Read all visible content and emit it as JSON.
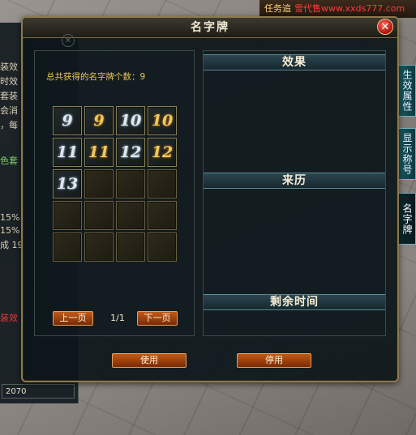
{
  "top_bar": {
    "task_label": "任务追",
    "watermark": "雪代售www.xxds777.com"
  },
  "background_left": {
    "lines": [
      "装效",
      "时效",
      "套装",
      "会消",
      "，每",
      "色套"
    ],
    "stats": [
      "15%",
      "15%",
      "成 19"
    ],
    "red_text": "装效",
    "footer_value": "2070"
  },
  "side_tabs": [
    {
      "label": "生效属性"
    },
    {
      "label": "显示称号"
    },
    {
      "label": "名字牌"
    }
  ],
  "window": {
    "title": "名字牌",
    "close_symbol": "✕",
    "count_label": "总共获得的名字牌个数：9",
    "slots": [
      {
        "text": "9",
        "tone": "silver"
      },
      {
        "text": "9",
        "tone": "gold"
      },
      {
        "text": "10",
        "tone": "silver"
      },
      {
        "text": "10",
        "tone": "gold"
      },
      {
        "text": "11",
        "tone": "silver"
      },
      {
        "text": "11",
        "tone": "gold"
      },
      {
        "text": "12",
        "tone": "silver"
      },
      {
        "text": "12",
        "tone": "gold"
      },
      {
        "text": "13",
        "tone": "silver"
      },
      {
        "text": "",
        "tone": ""
      },
      {
        "text": "",
        "tone": ""
      },
      {
        "text": "",
        "tone": ""
      },
      {
        "text": "",
        "tone": ""
      },
      {
        "text": "",
        "tone": ""
      },
      {
        "text": "",
        "tone": ""
      },
      {
        "text": "",
        "tone": ""
      },
      {
        "text": "",
        "tone": ""
      },
      {
        "text": "",
        "tone": ""
      },
      {
        "text": "",
        "tone": ""
      },
      {
        "text": "",
        "tone": ""
      }
    ],
    "prev_button": "上一页",
    "next_button": "下一页",
    "page_indicator": "1/1",
    "sections": {
      "effect": "效果",
      "source": "来历",
      "remaining_time": "剩余时间"
    },
    "use_button": "使用",
    "disable_button": "停用"
  },
  "colors": {
    "accent_gold": "#e8c850",
    "button_orange": "#c05a18",
    "close_red": "#a8120c"
  }
}
